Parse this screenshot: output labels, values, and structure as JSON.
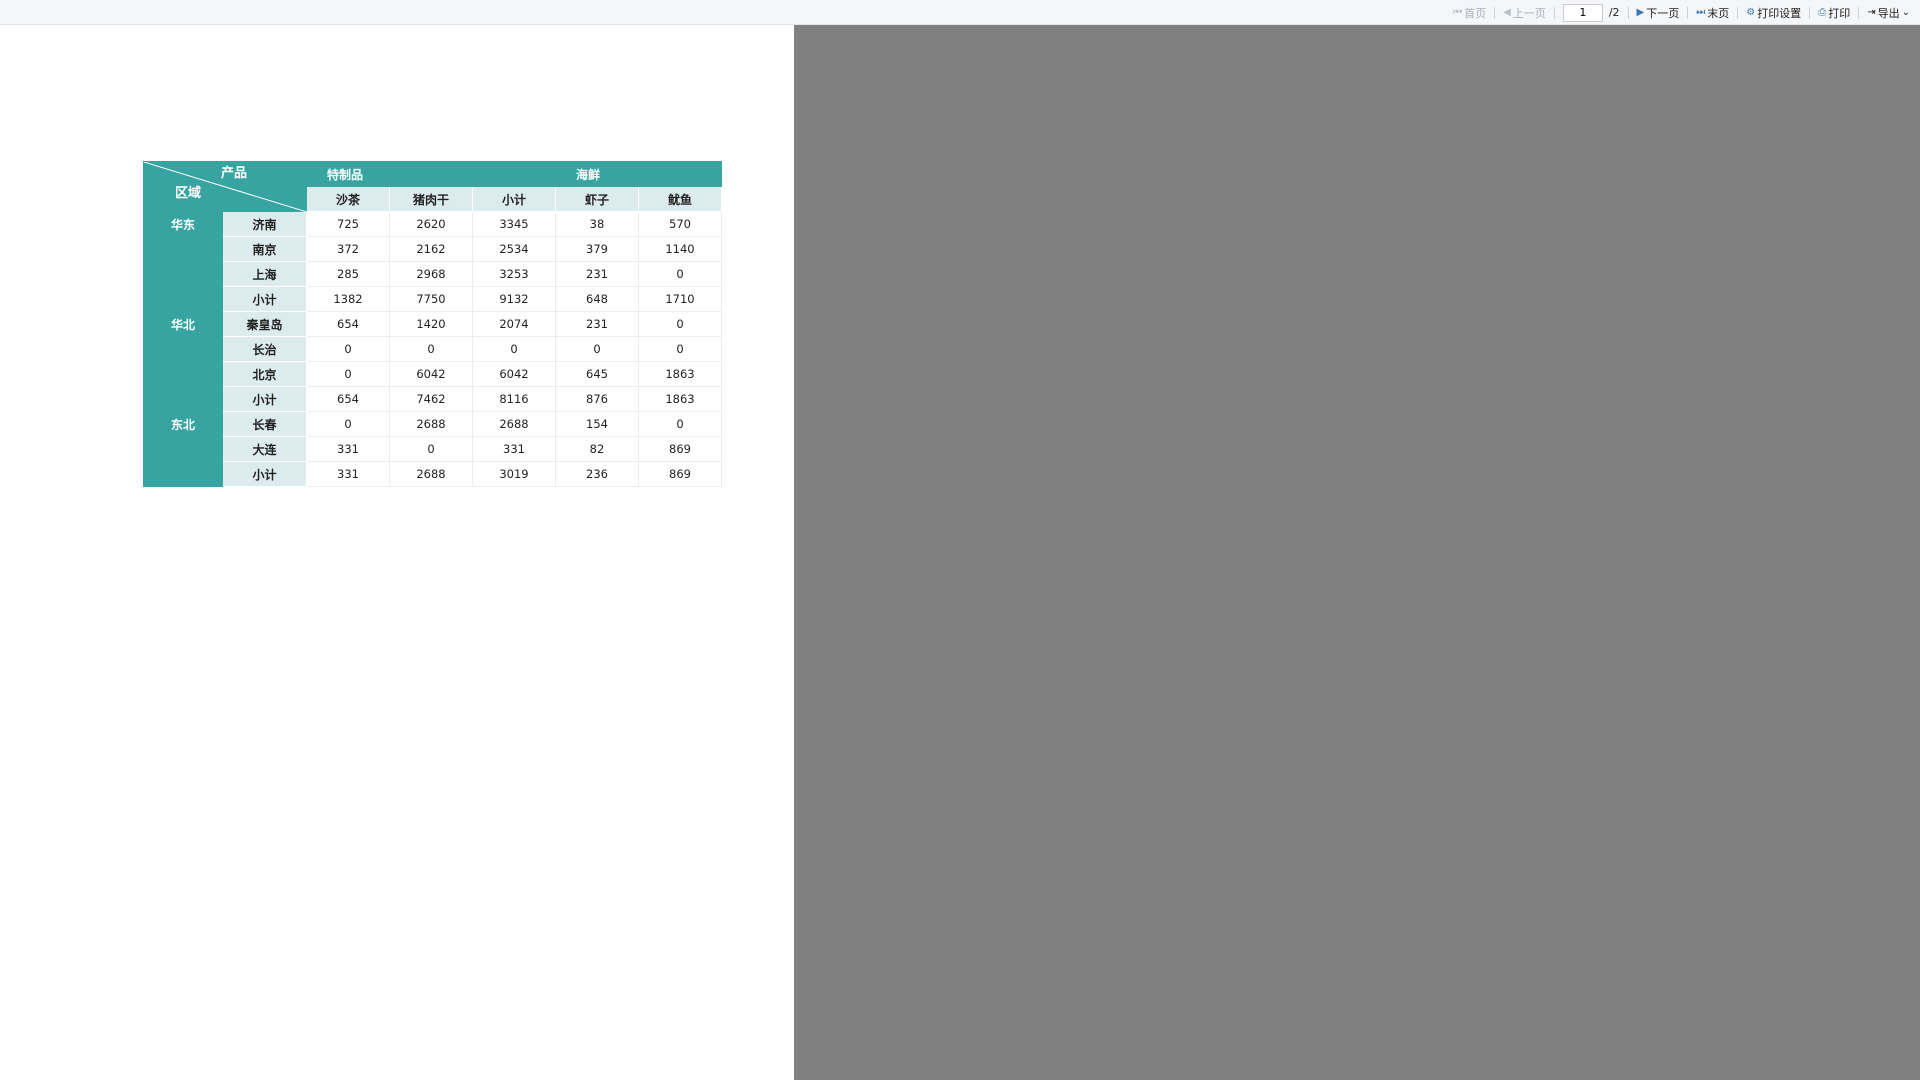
{
  "toolbar": {
    "first_page": "首页",
    "prev_page": "上一页",
    "page_input": "1",
    "page_total": "/2",
    "next_page": "下一页",
    "last_page": "末页",
    "print_settings": "打印设置",
    "print": "打印",
    "export": "导出"
  },
  "report": {
    "corner_col_header": "产品",
    "corner_row_header": "区域",
    "categories": [
      {
        "name": "特制品",
        "products": [
          "沙茶",
          "猪肉干",
          "小计"
        ]
      },
      {
        "name": "海鲜",
        "products": [
          "虾子",
          "鱿鱼"
        ]
      }
    ],
    "regions": [
      {
        "name": "华东",
        "rows": [
          {
            "city": "济南",
            "values": [
              "725",
              "2620",
              "3345",
              "38",
              "570"
            ]
          },
          {
            "city": "南京",
            "values": [
              "372",
              "2162",
              "2534",
              "379",
              "1140"
            ]
          },
          {
            "city": "上海",
            "values": [
              "285",
              "2968",
              "3253",
              "231",
              "0"
            ]
          },
          {
            "city": "小计",
            "values": [
              "1382",
              "7750",
              "9132",
              "648",
              "1710"
            ]
          }
        ]
      },
      {
        "name": "华北",
        "rows": [
          {
            "city": "秦皇岛",
            "values": [
              "654",
              "1420",
              "2074",
              "231",
              "0"
            ]
          },
          {
            "city": "长治",
            "values": [
              "0",
              "0",
              "0",
              "0",
              "0"
            ]
          },
          {
            "city": "北京",
            "values": [
              "0",
              "6042",
              "6042",
              "645",
              "1863"
            ]
          },
          {
            "city": "小计",
            "values": [
              "654",
              "7462",
              "8116",
              "876",
              "1863"
            ]
          }
        ]
      },
      {
        "name": "东北",
        "rows": [
          {
            "city": "长春",
            "values": [
              "0",
              "2688",
              "2688",
              "154",
              "0"
            ]
          },
          {
            "city": "大连",
            "values": [
              "331",
              "0",
              "331",
              "82",
              "869"
            ]
          },
          {
            "city": "小计",
            "values": [
              "331",
              "2688",
              "3019",
              "236",
              "869"
            ]
          }
        ]
      }
    ]
  },
  "colors": {
    "header_dark": "#37a4a2",
    "header_light": "#dcecee",
    "viewer_background": "#808080"
  }
}
